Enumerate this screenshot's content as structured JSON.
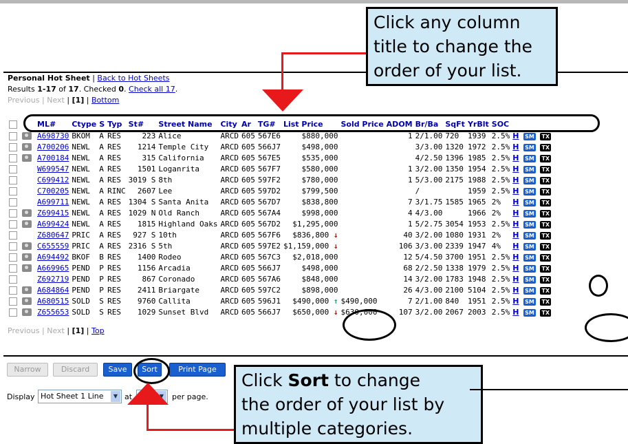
{
  "header": {
    "title": "Personal Hot Sheet",
    "back_link": "Back to Hot Sheets",
    "results_prefix": "Results",
    "results_range": "1-17",
    "results_of": "of",
    "results_total": "17",
    "checked_label": ". Checked",
    "checked_count": "0",
    "check_all": "Check all 17",
    "nav_previous": "Previous",
    "nav_next": "Next",
    "nav_page": "[1]",
    "nav_bottom": "Bottom",
    "nav_top": "Top"
  },
  "columns": [
    "ML#",
    "Ctype",
    "S",
    "Typ",
    "St#",
    "Street Name",
    "City",
    "Ar",
    "TG#",
    "List Price",
    "Sold Price",
    "ADOM",
    "Br/Ba",
    "SqFt",
    "YrBlt",
    "SOC"
  ],
  "rows": [
    {
      "cam": true,
      "ml": "A698730",
      "ctype": "BKOM",
      "s": "A",
      "typ": "RES",
      "st": "223",
      "street": "Alice",
      "city": "ARCD",
      "ar": "605",
      "tg": "567E6",
      "list": "$880,000",
      "trend": "",
      "sold": "",
      "adom": "1",
      "brba": "2/1.00",
      "sqft": "720",
      "yrblt": "1939",
      "soc": "2.5%"
    },
    {
      "cam": true,
      "ml": "A700206",
      "ctype": "NEWL",
      "s": "A",
      "typ": "RES",
      "st": "1214",
      "street": "Temple City",
      "city": "ARCD",
      "ar": "605",
      "tg": "566J7",
      "list": "$498,000",
      "trend": "",
      "sold": "",
      "adom": "",
      "brba": "3/3.00",
      "sqft": "1320",
      "yrblt": "1972",
      "soc": "2.5%"
    },
    {
      "cam": true,
      "ml": "A700184",
      "ctype": "NEWL",
      "s": "A",
      "typ": "RES",
      "st": "315",
      "street": "California",
      "city": "ARCD",
      "ar": "605",
      "tg": "567E5",
      "list": "$535,000",
      "trend": "",
      "sold": "",
      "adom": "",
      "brba": "4/2.50",
      "sqft": "1396",
      "yrblt": "1985",
      "soc": "2.5%"
    },
    {
      "cam": false,
      "ml": "W699547",
      "ctype": "NEWL",
      "s": "A",
      "typ": "RES",
      "st": "1501",
      "street": "Loganrita",
      "city": "ARCD",
      "ar": "605",
      "tg": "567F7",
      "list": "$580,000",
      "trend": "",
      "sold": "",
      "adom": "1",
      "brba": "3/2.00",
      "sqft": "1350",
      "yrblt": "1954",
      "soc": "2.5%"
    },
    {
      "cam": false,
      "ml": "C699412",
      "ctype": "NEWL",
      "s": "A",
      "typ": "RES",
      "st": "3019 S",
      "street": "8th",
      "city": "ARCD",
      "ar": "605",
      "tg": "597F2",
      "list": "$780,000",
      "trend": "",
      "sold": "",
      "adom": "1",
      "brba": "5/3.00",
      "sqft": "2175",
      "yrblt": "1988",
      "soc": "2.5%"
    },
    {
      "cam": false,
      "ml": "C700205",
      "ctype": "NEWL",
      "s": "A",
      "typ": "RINC",
      "st": "2607",
      "street": "Lee",
      "city": "ARCD",
      "ar": "605",
      "tg": "597D2",
      "list": "$799,500",
      "trend": "",
      "sold": "",
      "adom": "",
      "brba": "/",
      "sqft": "",
      "yrblt": "1959",
      "soc": "2.5%"
    },
    {
      "cam": false,
      "ml": "A699711",
      "ctype": "NEWL",
      "s": "A",
      "typ": "RES",
      "st": "1304 S",
      "street": "Santa Anita",
      "city": "ARCD",
      "ar": "605",
      "tg": "567D7",
      "list": "$838,800",
      "trend": "",
      "sold": "",
      "adom": "7",
      "brba": "3/1.75",
      "sqft": "1585",
      "yrblt": "1965",
      "soc": "2%"
    },
    {
      "cam": true,
      "ml": "Z699415",
      "ctype": "NEWL",
      "s": "A",
      "typ": "RES",
      "st": "1029 N",
      "street": "Old Ranch",
      "city": "ARCD",
      "ar": "605",
      "tg": "567A4",
      "list": "$998,000",
      "trend": "",
      "sold": "",
      "adom": "4",
      "brba": "4/3.00",
      "sqft": "",
      "yrblt": "1966",
      "soc": "2%"
    },
    {
      "cam": true,
      "ml": "A699424",
      "ctype": "NEWL",
      "s": "A",
      "typ": "RES",
      "st": "1815",
      "street": "Highland Oaks",
      "city": "ARCD",
      "ar": "605",
      "tg": "567D2",
      "list": "$1,295,000",
      "trend": "",
      "sold": "",
      "adom": "1",
      "brba": "5/2.75",
      "sqft": "3054",
      "yrblt": "1953",
      "soc": "2.5%"
    },
    {
      "cam": false,
      "ml": "Z680647",
      "ctype": "PRIC",
      "s": "A",
      "typ": "RES",
      "st": "927 S",
      "street": "10th",
      "city": "ARCD",
      "ar": "605",
      "tg": "567F6",
      "list": "$836,800",
      "trend": "down",
      "sold": "",
      "adom": "40",
      "brba": "3/2.00",
      "sqft": "1080",
      "yrblt": "1931",
      "soc": "2%"
    },
    {
      "cam": true,
      "ml": "C655559",
      "ctype": "PRIC",
      "s": "A",
      "typ": "RES",
      "st": "2316 S",
      "street": "5th",
      "city": "ARCD",
      "ar": "605",
      "tg": "597E2",
      "list": "$1,159,000",
      "trend": "down",
      "sold": "",
      "adom": "106",
      "brba": "3/3.00",
      "sqft": "2339",
      "yrblt": "1947",
      "soc": "4%"
    },
    {
      "cam": true,
      "ml": "A694492",
      "ctype": "BKOF",
      "s": "B",
      "typ": "RES",
      "st": "1400",
      "street": "Rodeo",
      "city": "ARCD",
      "ar": "605",
      "tg": "567C3",
      "list": "$2,018,000",
      "trend": "",
      "sold": "",
      "adom": "12",
      "brba": "5/4.50",
      "sqft": "3700",
      "yrblt": "1951",
      "soc": "2.5%"
    },
    {
      "cam": true,
      "ml": "A669965",
      "ctype": "PEND",
      "s": "P",
      "typ": "RES",
      "st": "1156",
      "street": "Arcadia",
      "city": "ARCD",
      "ar": "605",
      "tg": "566J7",
      "list": "$498,000",
      "trend": "",
      "sold": "",
      "adom": "68",
      "brba": "2/2.50",
      "sqft": "1338",
      "yrblt": "1979",
      "soc": "2.5%"
    },
    {
      "cam": false,
      "ml": "Z692719",
      "ctype": "PEND",
      "s": "P",
      "typ": "RES",
      "st": "867",
      "street": "Coronado",
      "city": "ARCD",
      "ar": "605",
      "tg": "567A6",
      "list": "$848,000",
      "trend": "",
      "sold": "",
      "adom": "14",
      "brba": "3/2.00",
      "sqft": "1783",
      "yrblt": "1948",
      "soc": "2.5%"
    },
    {
      "cam": true,
      "ml": "A684864",
      "ctype": "PEND",
      "s": "P",
      "typ": "RES",
      "st": "2411",
      "street": "Briargate",
      "city": "ARCD",
      "ar": "605",
      "tg": "597C2",
      "list": "$898,000",
      "trend": "",
      "sold": "",
      "adom": "26",
      "brba": "4/3.00",
      "sqft": "2100",
      "yrblt": "5104",
      "soc": "2.5%"
    },
    {
      "cam": true,
      "ml": "A680515",
      "ctype": "SOLD",
      "s": "S",
      "typ": "RES",
      "st": "9760",
      "street": "Callita",
      "city": "ARCD",
      "ar": "605",
      "tg": "596J1",
      "list": "$490,000",
      "trend": "up",
      "sold": "$490,000",
      "adom": "7",
      "brba": "2/1.00",
      "sqft": "840",
      "yrblt": "1951",
      "soc": "2.5%"
    },
    {
      "cam": true,
      "ml": "Z655653",
      "ctype": "SOLD",
      "s": "S",
      "typ": "RES",
      "st": "1029",
      "street": "Sunset Blvd",
      "city": "ARCD",
      "ar": "605",
      "tg": "566J7",
      "list": "$650,000",
      "trend": "down",
      "sold": "$630,000",
      "adom": "107",
      "brba": "3/2.00",
      "sqft": "2067",
      "yrblt": "2003",
      "soc": "2.5%"
    }
  ],
  "row_links": {
    "h": "H",
    "sm": "SM",
    "tx": "TX"
  },
  "buttons": {
    "narrow": "Narrow",
    "discard": "Discard",
    "save": "Save",
    "sort": "Sort",
    "print": "Print Page"
  },
  "display": {
    "label": "Display",
    "select_value": "Hot Sheet 1 Line",
    "at": "at",
    "per_page": "per page."
  },
  "callouts": {
    "top_line1": "Click any column",
    "top_line2": "title to change the",
    "top_line3": "order of your list.",
    "bottom_pre": "Click",
    "bottom_bold": "Sort",
    "bottom_line1_post": "to change",
    "bottom_line2": "the order of your list by",
    "bottom_line3": "multiple categories."
  },
  "colors": {
    "link": "#0000cc",
    "header": "#0000aa",
    "callout_bg": "#cfe9f6",
    "annotation": "#e8191a",
    "button_blue": "#1a5fd0"
  }
}
